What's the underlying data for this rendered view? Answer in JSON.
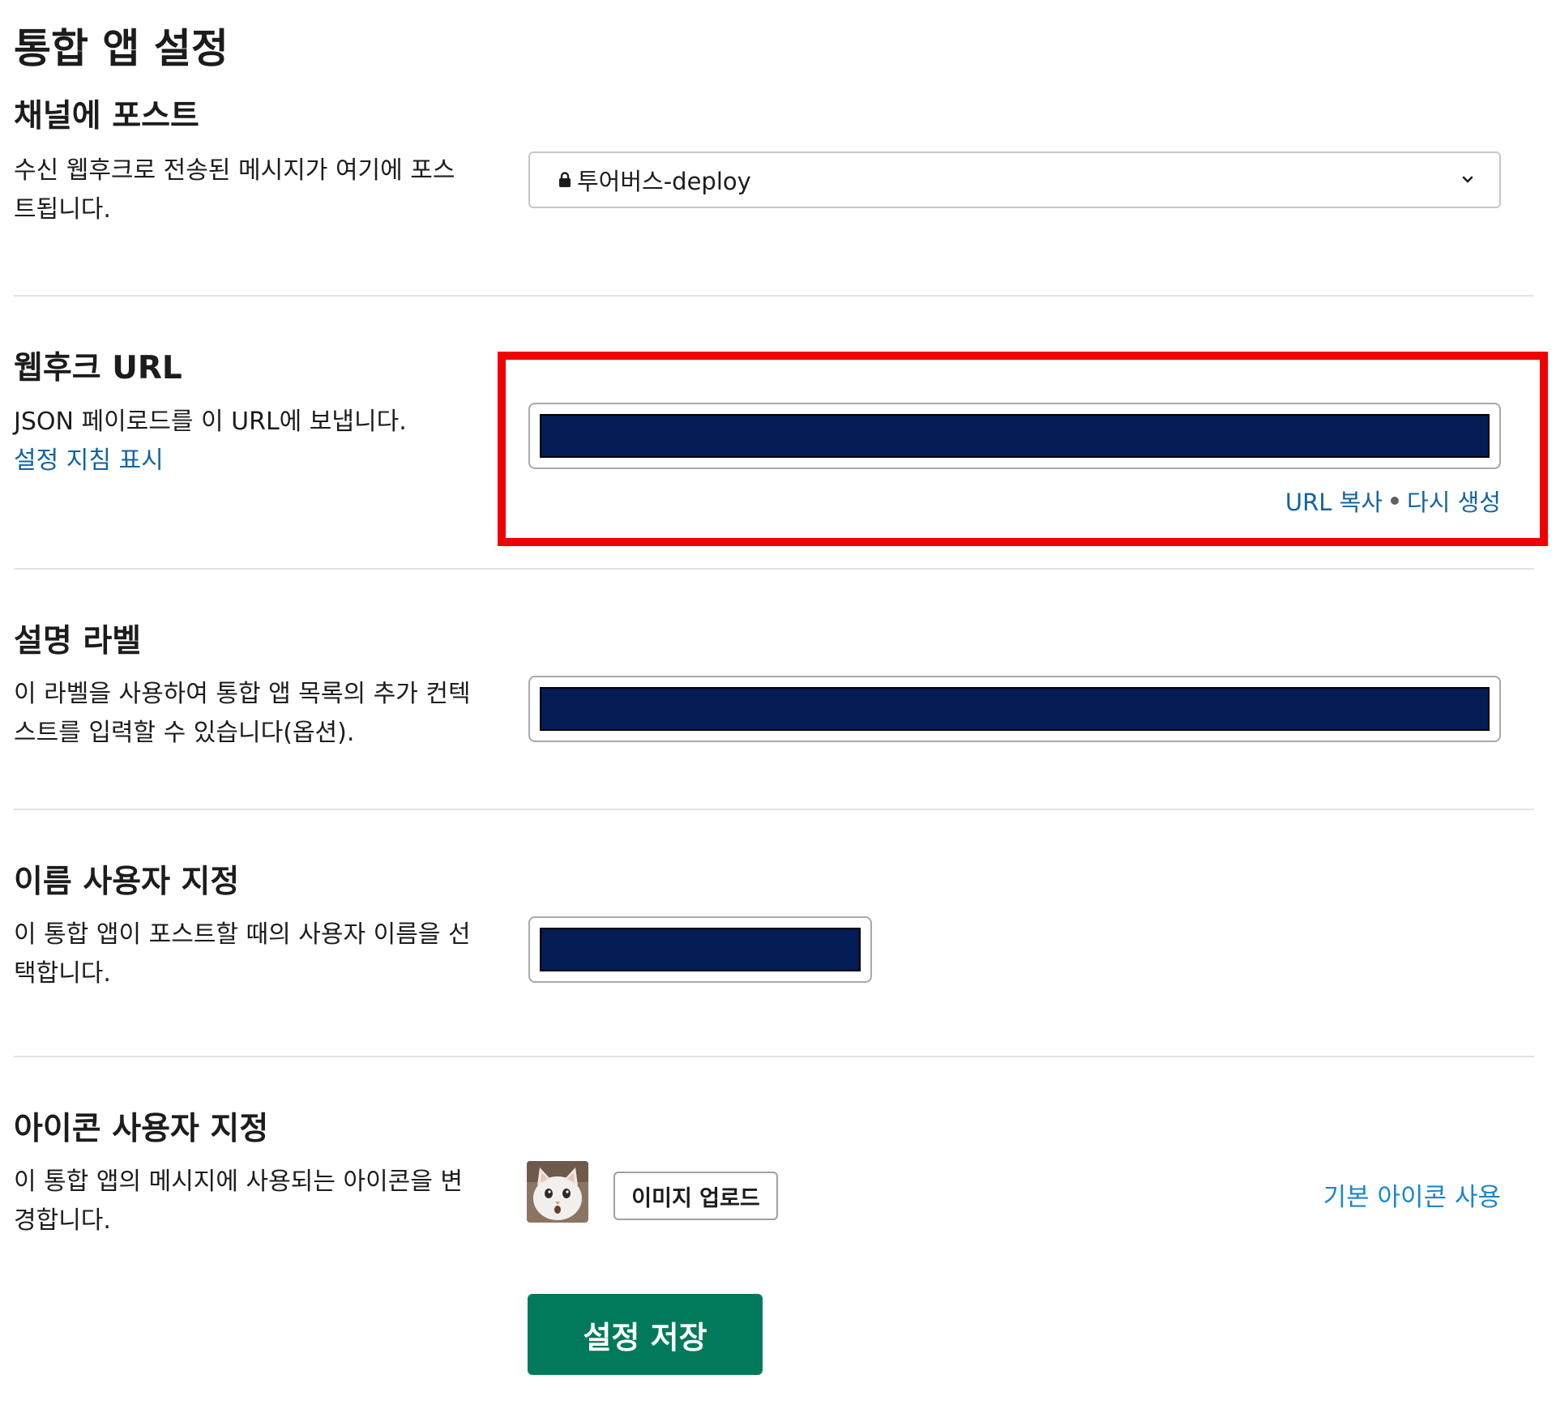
{
  "page": {
    "title": "통합 앱 설정"
  },
  "post_to_channel": {
    "title": "채널에 포스트",
    "description": "수신 웹후크로 전송된 메시지가 여기에 포스트됩니다.",
    "selected_channel": "투어버스-deploy",
    "lock_icon": "lock-icon",
    "chevron_icon": "chevron-down-icon"
  },
  "webhook_url": {
    "title": "웹후크 URL",
    "description": "JSON 페이로드를 이 URL에 보냅니다.",
    "setup_link": "설정 지침 표시",
    "value": "",
    "copy_link": "URL 복사",
    "regenerate_link": "다시 생성"
  },
  "descriptive_label": {
    "title": "설명 라벨",
    "description": "이 라벨을 사용하여 통합 앱 목록의 추가 컨텍스트를 입력할 수 있습니다(옵션).",
    "value": ""
  },
  "customize_name": {
    "title": "이름 사용자 지정",
    "description": "이 통합 앱이 포스트할 때의 사용자 이름을 선택합니다.",
    "value": ""
  },
  "customize_icon": {
    "title": "아이콘 사용자 지정",
    "description": "이 통합 앱의 메시지에 사용되는 아이콘을 변경합니다.",
    "upload_button": "이미지 업로드",
    "default_icon_link": "기본 아이콘 사용"
  },
  "actions": {
    "save_button": "설정 저장"
  },
  "colors": {
    "link": "#1264a3",
    "primary_button": "#007a5a",
    "redaction": "#031c54",
    "highlight": "#f20000"
  }
}
